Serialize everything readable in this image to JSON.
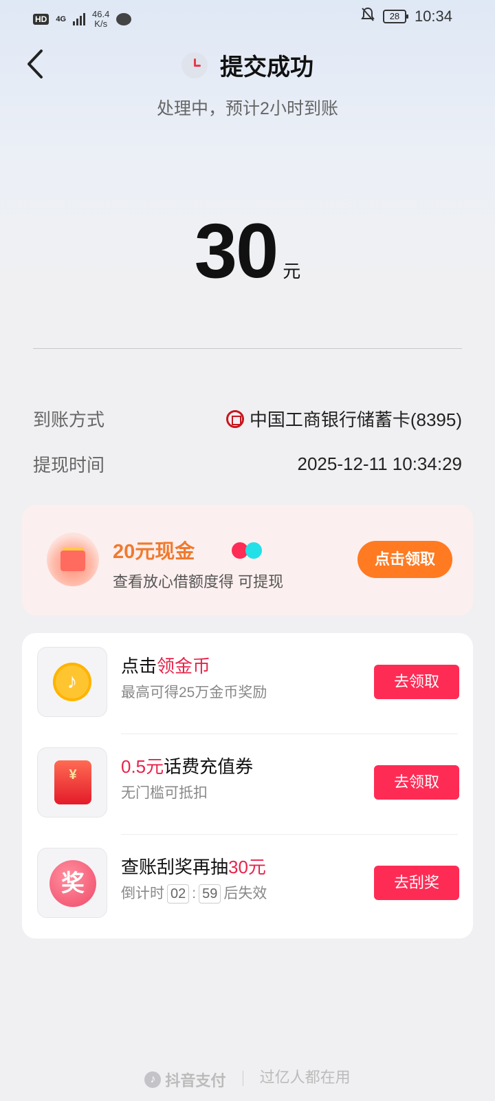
{
  "status_bar": {
    "hd": "HD",
    "network": "4G",
    "speed_value": "46.4",
    "speed_unit": "K/s",
    "battery": "28",
    "time": "10:34"
  },
  "header": {
    "title": "提交成功",
    "subtitle": "处理中，预计2小时到账"
  },
  "amount": {
    "value": "30",
    "unit": "元"
  },
  "details": [
    {
      "label": "到账方式",
      "value": "中国工商银行储蓄卡(8395)"
    },
    {
      "label": "提现时间",
      "value": "2025-12-11 10:34:29"
    }
  ],
  "promo": {
    "title": "20元现金",
    "desc": "查看放心借额度得 可提现",
    "button": "点击领取"
  },
  "tasks": [
    {
      "title_prefix": "点击",
      "title_highlight": "领金币",
      "title_suffix": "",
      "desc": "最高可得25万金币奖励",
      "button": "去领取"
    },
    {
      "title_prefix": "",
      "title_highlight": "0.5元",
      "title_suffix": "话费充值券",
      "desc": "无门槛可抵扣",
      "button": "去领取"
    },
    {
      "title_prefix": "查账刮奖再抽",
      "title_highlight": "30元",
      "title_suffix": "",
      "desc_prefix": "倒计时",
      "countdown_min": "02",
      "countdown_sep": ":",
      "countdown_sec": "59",
      "desc_suffix": "后失效",
      "button": "去刮奖",
      "icon_text": "奖"
    }
  ],
  "footer": {
    "brand": "抖音支付",
    "slogan": "过亿人都在用"
  },
  "colors": {
    "accent": "#fe2c55",
    "promo_orange": "#ff7a21",
    "highlight": "#e8234a"
  }
}
